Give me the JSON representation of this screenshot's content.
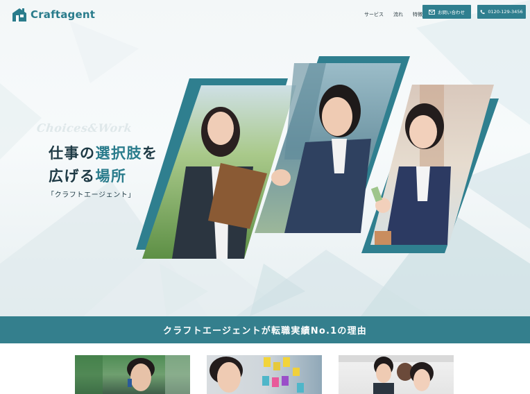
{
  "header": {
    "logo_text": "Craftagent",
    "nav": [
      {
        "label": "サービス"
      },
      {
        "label": "流れ"
      },
      {
        "label": "特徴"
      }
    ],
    "contact_button": "お問い合わせ",
    "phone_button": "0120-129-3456"
  },
  "hero": {
    "script_tagline": "Choices&Work",
    "headline_line1_a": "仕事の",
    "headline_line1_b": "選択肢",
    "headline_line1_c": "を",
    "headline_line2_a": "広げる",
    "headline_line2_b": "場所",
    "subline": "「クラフトエージェント」"
  },
  "band": {
    "text": "クラフトエージェントが転職実績No.1の理由"
  },
  "colors": {
    "brand": "#2f7f8f",
    "band": "#347f8d",
    "headline": "#1e3a45"
  },
  "icons": {
    "logo": "house-logo-icon",
    "contact": "mail-icon",
    "phone": "phone-icon"
  }
}
